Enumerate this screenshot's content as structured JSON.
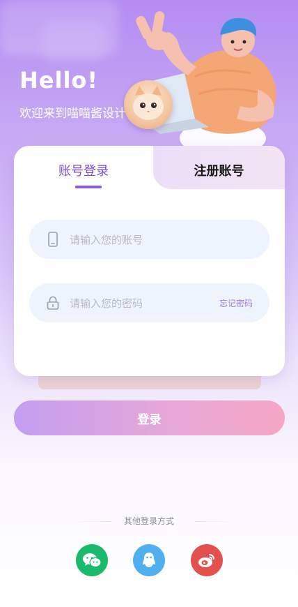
{
  "header": {
    "greeting": "Hello!",
    "welcome_text": "欢迎来到喵喵酱设计"
  },
  "tabs": [
    {
      "label": "账号登录",
      "active": true
    },
    {
      "label": "注册账号",
      "active": false
    }
  ],
  "form": {
    "account_placeholder": "请输入您的账号",
    "password_placeholder": "请输入您的密码",
    "forgot_label": "忘记密码"
  },
  "login_button": {
    "label": "登录"
  },
  "other_login": {
    "label": "其他登录方式",
    "providers": [
      {
        "name": "wechat",
        "icon": "wechat-icon",
        "color": "#1aba6c"
      },
      {
        "name": "qq",
        "icon": "qq-icon",
        "color": "#4fb0ef"
      },
      {
        "name": "weibo",
        "icon": "weibo-icon",
        "color": "#e4514d"
      }
    ]
  },
  "colors": {
    "accent": "#8b5ad8",
    "button_gradient_start": "#c39ef1",
    "button_gradient_end": "#f5a6c3",
    "field_background": "#eef4fd"
  }
}
